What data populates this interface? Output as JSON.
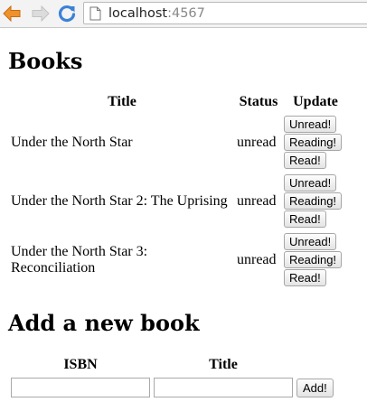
{
  "browser": {
    "url_host": "localhost",
    "url_port": ":4567",
    "back_icon": "back-arrow-icon",
    "forward_icon": "forward-arrow-icon",
    "reload_icon": "reload-icon",
    "accent": "#f0922b",
    "reload_color": "#3b82d6"
  },
  "books": {
    "heading": "Books",
    "columns": {
      "title": "Title",
      "status": "Status",
      "update": "Update"
    },
    "rows": [
      {
        "title": "Under the North Star",
        "status": "unread"
      },
      {
        "title": "Under the North Star 2: The Uprising",
        "status": "unread"
      },
      {
        "title": "Under the North Star 3: Reconciliation",
        "status": "unread"
      }
    ],
    "buttons": {
      "unread": "Unread!",
      "reading": "Reading!",
      "read": "Read!"
    }
  },
  "add_book": {
    "heading": "Add a new book",
    "isbn_label": "ISBN",
    "title_label": "Title",
    "isbn_value": "",
    "title_value": "",
    "submit_label": "Add!"
  }
}
